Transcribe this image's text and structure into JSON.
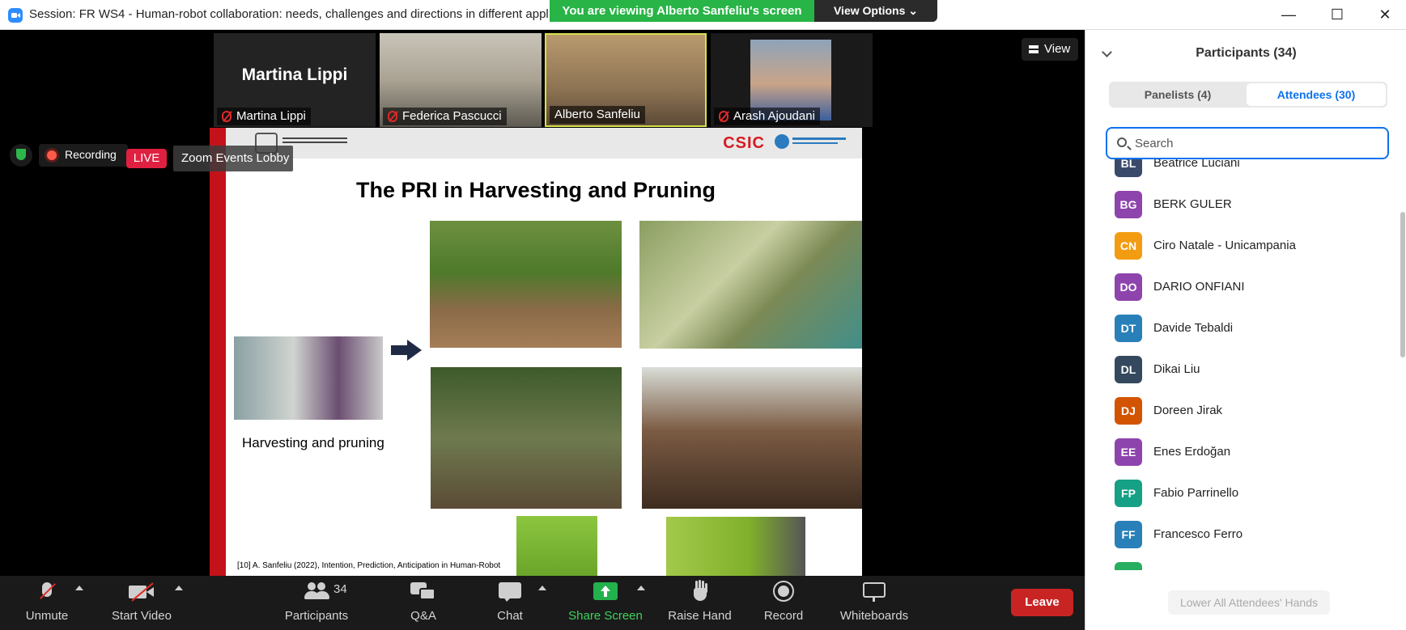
{
  "window": {
    "title": "Session: FR WS4 - Human-robot collaboration: needs, challenges and directions in different applic",
    "viewing_banner": "You are viewing Alberto Sanfeliu's screen",
    "view_options": "View Options ⌄",
    "minimize": "—",
    "maximize": "☐",
    "close": "✕"
  },
  "thumbnails": [
    {
      "name": "Martina Lippi",
      "big_label": "Martina Lippi"
    },
    {
      "name": "Federica Pascucci"
    },
    {
      "name": "Alberto Sanfeliu"
    },
    {
      "name": "Arash Ajoudani"
    }
  ],
  "view_button": "View",
  "overlay": {
    "recording": "Recording",
    "live": "LIVE",
    "lobby": "Zoom Events Lobby"
  },
  "slide": {
    "title": "The PRI in Harvesting and Pruning",
    "logo_csic": "CSIC",
    "caption": "Harvesting and pruning",
    "reference": "[10] A. Sanfeliu (2022), Intention, Prediction, Anticipation in Human-Robot"
  },
  "toolbar": {
    "unmute": "Unmute",
    "start_video": "Start Video",
    "participants": "Participants",
    "participants_count": "34",
    "qa": "Q&A",
    "chat": "Chat",
    "share_screen": "Share Screen",
    "raise_hand": "Raise Hand",
    "record": "Record",
    "whiteboards": "Whiteboards",
    "leave": "Leave"
  },
  "panel": {
    "title": "Participants (34)",
    "tab_panelists": "Panelists (4)",
    "tab_attendees": "Attendees (30)",
    "search_placeholder": "Search",
    "lower_hands": "Lower All Attendees' Hands",
    "attendees": [
      {
        "initials": "BL",
        "name": "Beatrice Luciani",
        "color": "#3a4a6b"
      },
      {
        "initials": "BG",
        "name": "BERK GULER",
        "color": "#8e44ad"
      },
      {
        "initials": "CN",
        "name": "Ciro Natale - Unicampania",
        "color": "#f39c12"
      },
      {
        "initials": "DO",
        "name": "DARIO ONFIANI",
        "color": "#8e44ad"
      },
      {
        "initials": "DT",
        "name": "Davide Tebaldi",
        "color": "#2980b9"
      },
      {
        "initials": "DL",
        "name": "Dikai Liu",
        "color": "#34495e"
      },
      {
        "initials": "DJ",
        "name": "Doreen Jirak",
        "color": "#d35400"
      },
      {
        "initials": "EE",
        "name": "Enes Erdoğan",
        "color": "#8e44ad"
      },
      {
        "initials": "FP",
        "name": "Fabio Parrinello",
        "color": "#16a085"
      },
      {
        "initials": "FF",
        "name": "Francesco Ferro",
        "color": "#2980b9"
      }
    ]
  }
}
